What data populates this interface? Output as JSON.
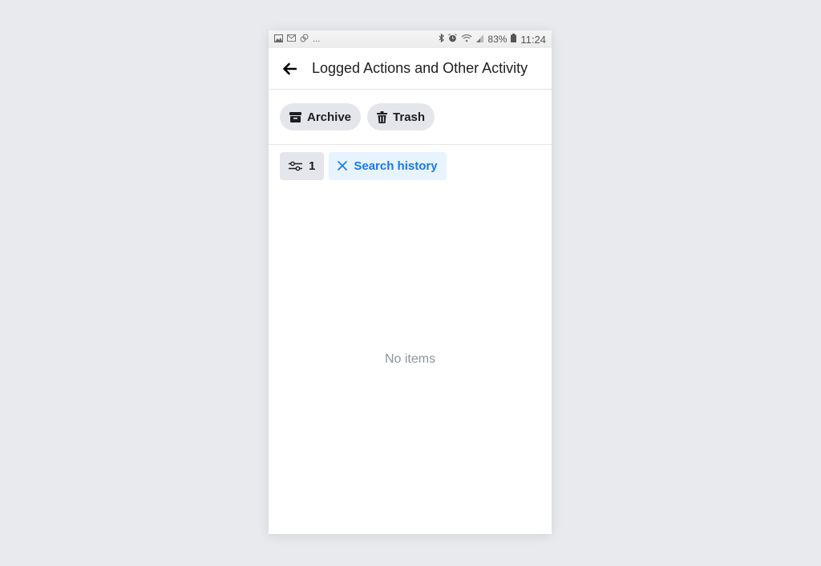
{
  "status_bar": {
    "left_icons": [
      "image-icon",
      "gmail-icon",
      "link-icon"
    ],
    "more": "...",
    "right_icons": [
      "bluetooth-icon",
      "alarm-icon",
      "wifi-icon",
      "signal-icon"
    ],
    "battery": "83%",
    "time": "11:24"
  },
  "header": {
    "title": "Logged Actions and Other Activity",
    "back_icon": "arrow-left-icon"
  },
  "actions": [
    {
      "label": "Archive",
      "icon": "archive-icon"
    },
    {
      "label": "Trash",
      "icon": "trash-icon"
    }
  ],
  "filters": {
    "filter_count": "1",
    "active_filter": "Search history"
  },
  "empty_state": {
    "message": "No items"
  },
  "colors": {
    "accent": "#1877f2",
    "chip_bg": "#e4e6eb",
    "active_chip_bg": "#e7f3ff",
    "empty_text": "#8d949e"
  }
}
